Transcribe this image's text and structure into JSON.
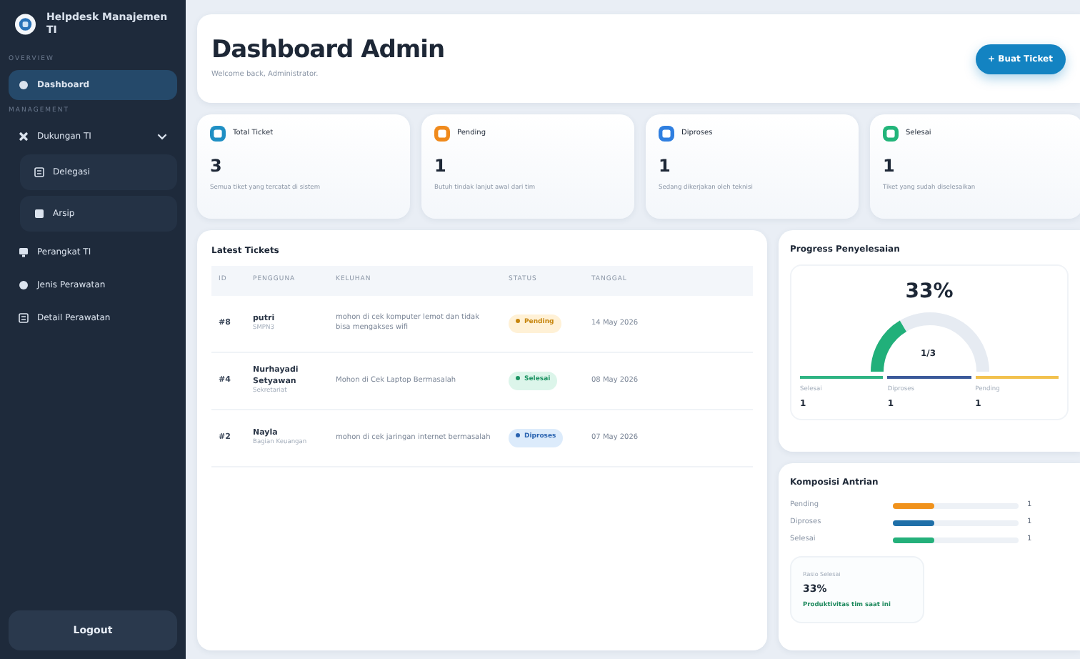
{
  "brand": {
    "title": "Helpdesk Manajemen TI"
  },
  "sidebar": {
    "sections": [
      {
        "label": "OVERVIEW",
        "items": [
          {
            "label": "Dashboard",
            "selected": true
          }
        ]
      },
      {
        "label": "MANAGEMENT",
        "items": [
          {
            "label": "Dukungan TI",
            "selected": false,
            "expanded": true,
            "children": [
              {
                "label": "Delegasi",
                "selected": false
              },
              {
                "label": "Arsip",
                "selected": false
              }
            ]
          },
          {
            "label": "Perangkat TI",
            "selected": false
          },
          {
            "label": "Jenis Perawatan",
            "selected": false
          },
          {
            "label": "Detail Perawatan",
            "selected": false
          }
        ]
      }
    ],
    "logout": "Logout"
  },
  "header": {
    "title": "Dashboard Admin",
    "subtitle": "Welcome back, Administrator.",
    "button": "+ Buat Ticket"
  },
  "stats": [
    {
      "label": "Total Ticket",
      "value": "3",
      "note": "Semua tiket yang tercatat di sistem",
      "color": "#1f8fc4"
    },
    {
      "label": "Pending",
      "value": "1",
      "note": "Butuh tindak lanjut awal dari tim",
      "color": "#f08a1c"
    },
    {
      "label": "Diproses",
      "value": "1",
      "note": "Sedang dikerjakan oleh teknisi",
      "color": "#2f7fe0"
    },
    {
      "label": "Selesai",
      "value": "1",
      "note": "Tiket yang sudah diselesaikan",
      "color": "#22b57a"
    }
  ],
  "tickets": {
    "title": "Latest Tickets",
    "columns": [
      "ID",
      "PENGGUNA",
      "KELUHAN",
      "STATUS",
      "TANGGAL"
    ],
    "rows": [
      {
        "id": "#8",
        "user": "putri",
        "unit": "SMPN3",
        "complaint": "mohon di cek komputer lemot dan tidak bisa mengakses wifi",
        "status": {
          "label": "Pending",
          "kind": "pending"
        },
        "date": "14 May 2026"
      },
      {
        "id": "#4",
        "user": "Nurhayadi Setyawan",
        "unit": "Sekretariat",
        "complaint": "Mohon di Cek Laptop Bermasalah",
        "status": {
          "label": "Selesai",
          "kind": "done"
        },
        "date": "08 May 2026"
      },
      {
        "id": "#2",
        "user": "Nayla",
        "unit": "Bagian Keuangan",
        "complaint": "mohon di cek jaringan internet bermasalah",
        "status": {
          "label": "Diproses",
          "kind": "progress"
        },
        "date": "07 May 2026"
      }
    ]
  },
  "progress": {
    "title": "Progress Penyelesaian",
    "percent": "33%",
    "fraction": "1/3",
    "legend": [
      {
        "label": "Selesai",
        "value": "1",
        "color": "#2fb483"
      },
      {
        "label": "Diproses",
        "value": "1",
        "color": "#3b5a9a"
      },
      {
        "label": "Pending",
        "value": "1",
        "color": "#f2c14e"
      }
    ]
  },
  "composition": {
    "title": "Komposisi Antrian",
    "rows": [
      {
        "label": "Pending",
        "level": 0.33,
        "value": "1",
        "color": "#f0921c"
      },
      {
        "label": "Diproses",
        "level": 0.33,
        "value": "1",
        "color": "#1f6fa8"
      },
      {
        "label": "Selesai",
        "level": 0.33,
        "value": "1",
        "color": "#24b07a"
      }
    ],
    "ratio": {
      "label": "Rasio Selesai",
      "value": "33%",
      "note": "Produktivitas tim saat ini"
    }
  }
}
